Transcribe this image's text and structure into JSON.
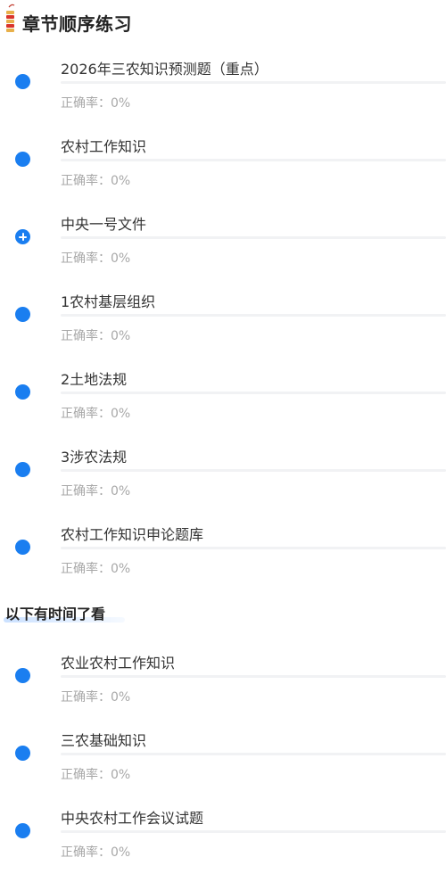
{
  "header": {
    "title": "章节顺序练习"
  },
  "chapters": [
    {
      "title": "2026年三农知识预测题（重点）",
      "accuracy": "正确率：0%",
      "progress": 0,
      "icon": "dot-icon"
    },
    {
      "title": "农村工作知识",
      "accuracy": "正确率：0%",
      "progress": 0,
      "icon": "dot-icon"
    },
    {
      "title": "中央一号文件",
      "accuracy": "正确率：0%",
      "progress": 0,
      "icon": "plus-circle-icon"
    },
    {
      "title": "1农村基层组织",
      "accuracy": "正确率：0%",
      "progress": 0,
      "icon": "dot-icon"
    },
    {
      "title": "2土地法规",
      "accuracy": "正确率：0%",
      "progress": 0,
      "icon": "dot-icon"
    },
    {
      "title": "3涉农法规",
      "accuracy": "正确率：0%",
      "progress": 0,
      "icon": "dot-icon"
    },
    {
      "title": "农村工作知识申论题库",
      "accuracy": "正确率：0%",
      "progress": 0,
      "icon": "dot-icon"
    }
  ],
  "subheader": {
    "title": "以下有时间了看"
  },
  "extra_chapters": [
    {
      "title": "农业农村工作知识",
      "accuracy": "正确率：0%",
      "progress": 0,
      "icon": "dot-icon"
    },
    {
      "title": "三农基础知识",
      "accuracy": "正确率：0%",
      "progress": 0,
      "icon": "dot-icon"
    },
    {
      "title": "中央农村工作会议试题",
      "accuracy": "正确率：0%",
      "progress": 0,
      "icon": "dot-icon"
    }
  ],
  "colors": {
    "accent": "#1a7ef0",
    "muted_text": "#a8a8a8",
    "title_text": "#222222"
  }
}
